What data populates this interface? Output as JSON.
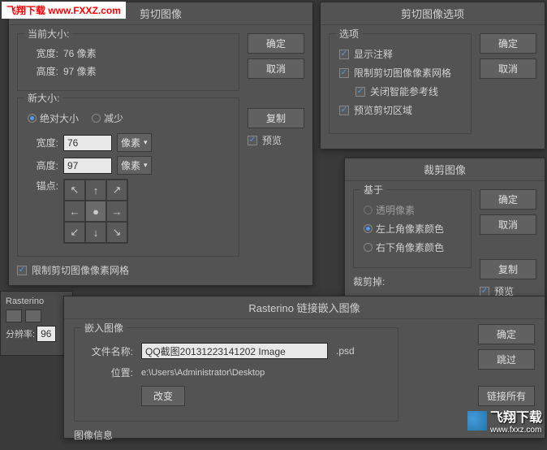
{
  "watermark1_text": "飞翔下载 www.FXXZ.com",
  "watermark2_text": "飞翔下载",
  "watermark2_url": "www.fxxz.com",
  "bg_panel": {
    "title": "Rasterino",
    "label": "分辨率:",
    "value": "96"
  },
  "dialog1": {
    "title": "剪切图像",
    "ok": "确定",
    "cancel": "取消",
    "copy": "复制",
    "preview_label": "预览",
    "current_size": {
      "title": "当前大小:",
      "width_label": "宽度:",
      "width_val": "76 像素",
      "height_label": "高度:",
      "height_val": "97 像素"
    },
    "new_size": {
      "title": "新大小:",
      "abs": "绝对大小",
      "dec": "减少",
      "width_label": "宽度:",
      "width_val": "76",
      "height_label": "高度:",
      "height_val": "97",
      "unit": "像素",
      "anchor_label": "锚点:"
    },
    "limit_grid": "限制剪切图像像素网格"
  },
  "dialog2": {
    "title": "剪切图像选项",
    "ok": "确定",
    "cancel": "取消",
    "options_title": "选项",
    "show_ann": "显示注释",
    "limit_grid": "限制剪切图像像素网格",
    "close_guides": "关闭智能参考线",
    "preview_area": "预览剪切区域"
  },
  "dialog3": {
    "title": "Rasterino 链接嵌入图像",
    "embed_title": "嵌入图像",
    "filename_label": "文件名称:",
    "filename_val": "QQ截图20131223141202 Image",
    "ext": ".psd",
    "location_label": "位置:",
    "location_val": "e:\\Users\\Administrator\\Desktop",
    "change": "改变",
    "info_title": "图像信息",
    "ok": "确定",
    "skip": "跳过",
    "link_all": "链接所有"
  },
  "dialog4": {
    "title": "裁剪图像",
    "ok": "确定",
    "cancel": "取消",
    "copy": "复制",
    "based_title": "基于",
    "transparent": "透明像素",
    "topleft": "左上角像素颜色",
    "bottomright": "右下角像素颜色",
    "crop_label": "裁剪掉:",
    "preview": "预览"
  }
}
